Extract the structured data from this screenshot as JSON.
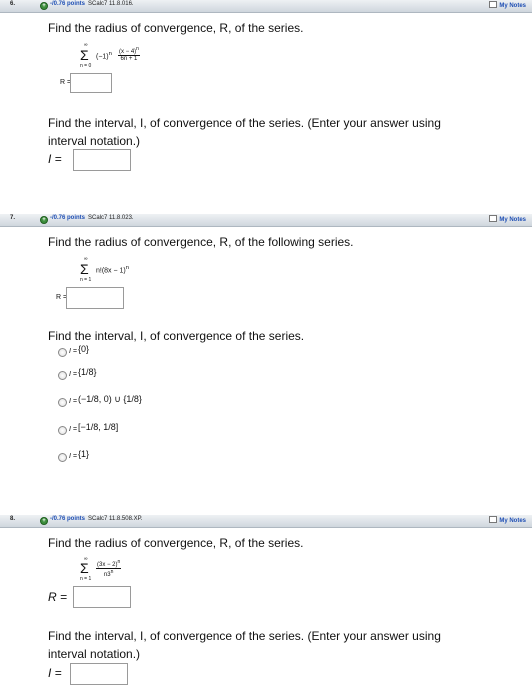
{
  "questions": [
    {
      "number": "6.",
      "points": "-/0.76 points",
      "reference": "SCalc7 11.8.016.",
      "notes_label": "My Notes",
      "radius_prompt": "Find the radius of convergence, R, of the series.",
      "series_terms": [
        "(−1)",
        "n",
        "(x − 4)",
        "n",
        "6n + 1"
      ],
      "sum_lower": "n = 0",
      "sum_upper": "∞",
      "radius_label": "R =",
      "interval_prompt_1": "Find the interval, I, of convergence of the series. (Enter your answer using",
      "interval_prompt_2": "interval notation.)",
      "interval_label": "I ="
    },
    {
      "number": "7.",
      "points": "-/0.76 points",
      "reference": "SCalc7 11.8.023.",
      "notes_label": "My Notes",
      "radius_prompt": "Find the radius of convergence, R, of the following series.",
      "series_text": "n!(8x − 1)",
      "series_exp": "n",
      "sum_lower": "n = 1",
      "sum_upper": "∞",
      "radius_label": "R =",
      "interval_prompt": "Find the interval, I, of convergence of the series.",
      "options": [
        {
          "label": "I =",
          "expr": "{0}"
        },
        {
          "label": "I =",
          "expr": "{1/8}"
        },
        {
          "label": "I =",
          "expr": "(−1/8, 0) ∪ {1/8}"
        },
        {
          "label": "I =",
          "expr": "[−1/8, 1/8]"
        },
        {
          "label": "I =",
          "expr": "{1}"
        }
      ]
    },
    {
      "number": "8.",
      "points": "-/0.76 points",
      "reference": "SCalc7 11.8.508.XP.",
      "notes_label": "My Notes",
      "radius_prompt": "Find the radius of convergence, R, of the series.",
      "series_num": "(3x − 2)",
      "series_num_exp": "n",
      "series_den": "n3",
      "series_den_exp": "n",
      "sum_lower": "n = 1",
      "sum_upper": "∞",
      "radius_label": "R =",
      "interval_prompt_1": "Find the interval, I, of convergence of the series. (Enter your answer using",
      "interval_prompt_2": "interval notation.)",
      "interval_label": "I ="
    }
  ]
}
